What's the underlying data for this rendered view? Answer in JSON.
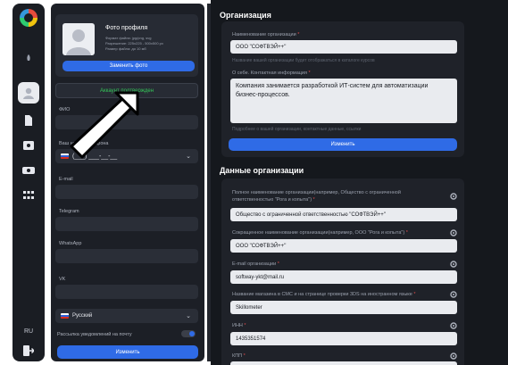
{
  "sidebar": {
    "lang": "RU"
  },
  "profile": {
    "photo_title": "Фото профиля",
    "photo_notes": [
      "Формат файла: jpg/png, svg",
      "Разрешение: 225х225 - 500х500 px",
      "Размер файла: до 10 мб"
    ],
    "change_photo": "Заменить фото",
    "verified": "Аккаунт подтвержден",
    "fio_label": "ФИО",
    "phone_label": "Ваш номер телефона",
    "phone_value": "(___) ___-__-__",
    "email_label": "E-mail",
    "telegram_label": "Telegram",
    "whatsapp_label": "WhatsApp",
    "vk_label": "VK",
    "language": "Русский",
    "newsletter": "Рассылка уведомлений на почту",
    "save": "Изменить"
  },
  "org": {
    "title": "Организация",
    "name_label": "Наименование организации",
    "name_value": "ООО \"СОФТВЭЙ++\"",
    "name_hint": "Название вашей организации будет отображаться в каталоге курсов",
    "about_label": "О себе. Контактная информация",
    "about_value": "Компания занимается разработкой ИТ-систем для автоматизации бизнес-процессов.",
    "about_hint": "Подробнее о вашей организации, контактные данные, ссылки",
    "save": "Изменить"
  },
  "org_data": {
    "title": "Данные организации",
    "fields": [
      {
        "label": "Полное наименование организации(например, Общество с ограниченной ответственностью \"Рога и копыта\")",
        "value": "Общество с ограниченной ответственностью \"СОФТВЭЙ++\""
      },
      {
        "label": "Сокращенное наименование организации(например, ООО \"Рога и копыта\")",
        "value": "ООО \"СОФТВЭЙ++\""
      },
      {
        "label": "E-mail организации",
        "value": "softway-ykt@mail.ru"
      },
      {
        "label": "Название магазина в СМС и на странице проверки 3DS на иностранном языке",
        "value": "Skillometer"
      },
      {
        "label": "ИНН",
        "value": "1435351574"
      },
      {
        "label": "КПП",
        "value": ""
      }
    ]
  },
  "colors": {
    "accent": "#2f6be6",
    "verified": "#35c759",
    "required": "#e04b4b"
  }
}
